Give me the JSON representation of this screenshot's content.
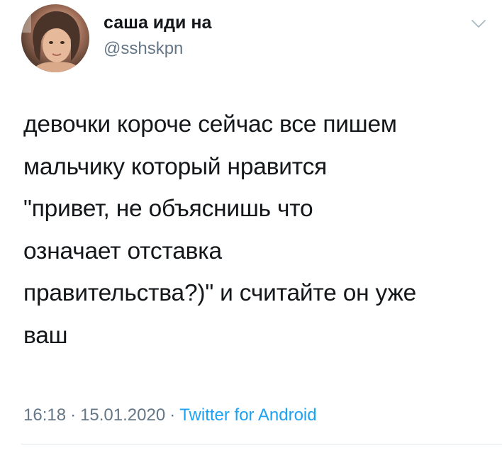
{
  "author": {
    "display_name": "саша иди на",
    "handle": "@sshskpn"
  },
  "tweet": {
    "text": "девочки короче сейчас все пишем\nмальчику который нравится\n\"привет, не объяснишь что\nозначает отставка\nправительства?)\" и считайте он уже\nваш",
    "time": "16:18",
    "separator": "·",
    "date": "15.01.2020",
    "source": "Twitter for Android"
  },
  "icons": {
    "menu": "chevron-down-icon",
    "avatar": "profile-photo"
  },
  "colors": {
    "text": "#14171a",
    "secondary": "#657786",
    "link": "#1da1f2",
    "divider": "#e1e8ed"
  }
}
